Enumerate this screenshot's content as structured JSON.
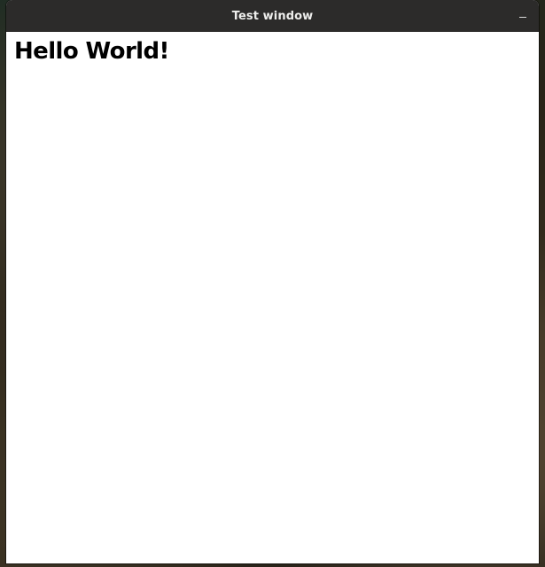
{
  "window": {
    "title": "Test window",
    "minimize_icon": "minimize-icon"
  },
  "content": {
    "heading": "Hello World!"
  },
  "colors": {
    "titlebar_bg": "#2c2b2a",
    "titlebar_text": "#eeeeec",
    "content_bg": "#ffffff",
    "heading_text": "#000000"
  }
}
